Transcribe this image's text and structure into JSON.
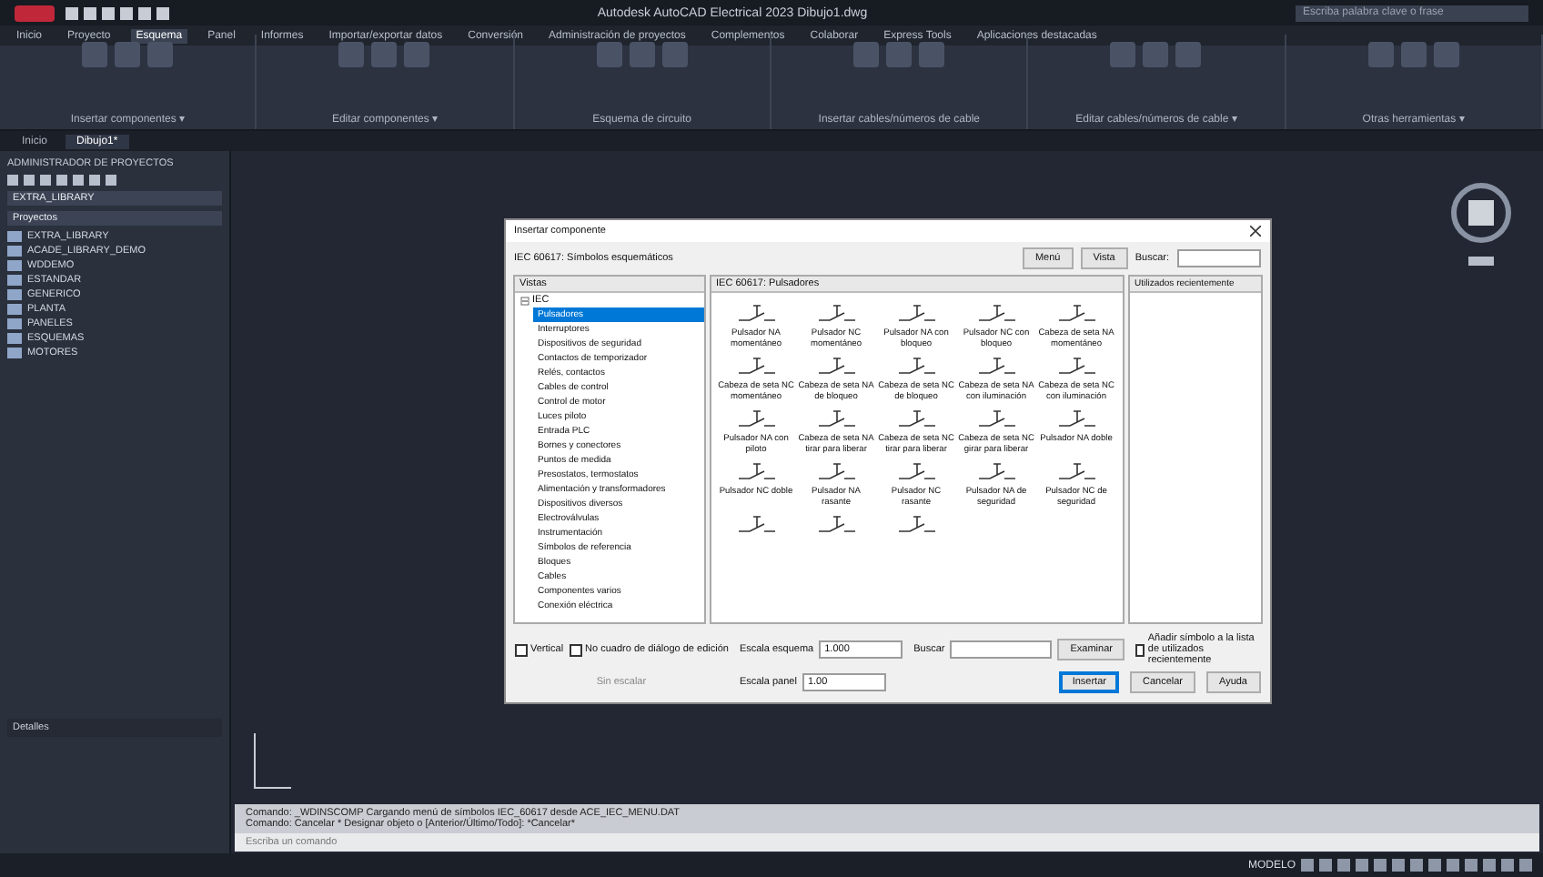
{
  "app": {
    "title": "Autodesk AutoCAD Electrical 2023  Dibujo1.dwg",
    "search_placeholder": "Escriba palabra clave o frase"
  },
  "ribbon_tabs": [
    {
      "label": "Inicio",
      "selected": false
    },
    {
      "label": "Proyecto",
      "selected": false
    },
    {
      "label": "Esquema",
      "selected": true
    },
    {
      "label": "Panel",
      "selected": false
    },
    {
      "label": "Informes",
      "selected": false
    },
    {
      "label": "Importar/exportar datos",
      "selected": false
    },
    {
      "label": "Conversión",
      "selected": false
    },
    {
      "label": "Administración de proyectos",
      "selected": false
    },
    {
      "label": "Complementos",
      "selected": false
    },
    {
      "label": "Colaborar",
      "selected": false
    },
    {
      "label": "Express Tools",
      "selected": false
    },
    {
      "label": "Aplicaciones destacadas",
      "selected": false
    }
  ],
  "ribbon_panels": [
    "Insertar componentes ▾",
    "Editar componentes ▾",
    "Esquema de circuito",
    "Insertar cables/números de cable",
    "Editar cables/números de cable ▾",
    "Otras herramientas ▾"
  ],
  "file_tabs": [
    {
      "label": "Inicio",
      "selected": false
    },
    {
      "label": "Dibujo1*",
      "selected": true
    }
  ],
  "palette": {
    "title": "ADMINISTRADOR DE PROYECTOS",
    "project": "EXTRA_LIBRARY",
    "filter": "Proyectos",
    "projects": [
      "EXTRA_LIBRARY",
      "ACADE_LIBRARY_DEMO",
      "WDDEMO",
      "ESTANDAR",
      "GENERICO",
      "PLANTA",
      "PANELES",
      "ESQUEMAS",
      "MOTORES"
    ],
    "details": "Detalles"
  },
  "dialog": {
    "title": "Insertar componente",
    "subtitle": "IEC 60617: Símbolos esquemáticos",
    "menu_button": "Menú",
    "view_button": "Vista",
    "search_label": "Buscar:",
    "tree_header": "Vistas",
    "tree": [
      {
        "label": "IEC",
        "expanded": true,
        "children": [
          {
            "label": "Pulsadores",
            "selected": true
          },
          {
            "label": "Interruptores",
            "selected": false
          },
          {
            "label": "Dispositivos de seguridad",
            "selected": false
          },
          {
            "label": "Contactos de temporizador",
            "selected": false
          },
          {
            "label": "Relés, contactos",
            "selected": false
          },
          {
            "label": "Cables de control",
            "selected": false
          },
          {
            "label": "Control de motor",
            "selected": false
          },
          {
            "label": "Luces piloto",
            "selected": false
          },
          {
            "label": "Entrada PLC",
            "selected": false
          },
          {
            "label": "Bornes y conectores",
            "selected": false
          },
          {
            "label": "Puntos de medida",
            "selected": false
          },
          {
            "label": "Presostatos, termostatos",
            "selected": false
          },
          {
            "label": "Alimentación y transformadores",
            "selected": false
          },
          {
            "label": "Dispositivos diversos",
            "selected": false
          },
          {
            "label": "Electroválvulas",
            "selected": false
          },
          {
            "label": "Instrumentación",
            "selected": false
          },
          {
            "label": "Símbolos de referencia",
            "selected": false
          },
          {
            "label": "Bloques",
            "selected": false
          },
          {
            "label": "Cables",
            "selected": false
          },
          {
            "label": "Componentes varios",
            "selected": false
          },
          {
            "label": "Conexión eléctrica",
            "selected": false
          }
        ]
      }
    ],
    "grid_header": "IEC 60617: Pulsadores",
    "symbols": [
      {
        "kind": "labeled",
        "label": "Pulsador NA momentáneo"
      },
      {
        "kind": "labeled",
        "label": "Pulsador NC momentáneo"
      },
      {
        "kind": "labeled",
        "label": "Pulsador NA con bloqueo"
      },
      {
        "kind": "labeled",
        "label": "Pulsador NC con bloqueo"
      },
      {
        "kind": "labeled",
        "label": "Cabeza de seta NA momentáneo"
      },
      {
        "kind": "labeled",
        "label": "Cabeza de seta NC momentáneo"
      },
      {
        "kind": "labeled",
        "label": "Cabeza de seta NA de bloqueo"
      },
      {
        "kind": "labeled",
        "label": "Cabeza de seta NC de bloqueo"
      },
      {
        "kind": "labeled",
        "label": "Cabeza de seta NA con iluminación"
      },
      {
        "kind": "labeled",
        "label": "Cabeza de seta NC con iluminación"
      },
      {
        "kind": "labeled",
        "label": "Pulsador NA con piloto"
      },
      {
        "kind": "labeled",
        "label": "Cabeza de seta NA tirar para liberar"
      },
      {
        "kind": "labeled",
        "label": "Cabeza de seta NC tirar para liberar"
      },
      {
        "kind": "labeled",
        "label": "Cabeza de seta NC girar para liberar"
      },
      {
        "kind": "labeled",
        "label": "Pulsador NA doble"
      },
      {
        "kind": "labeled",
        "label": "Pulsador NC doble"
      },
      {
        "kind": "labeled",
        "label": "Pulsador NA rasante"
      },
      {
        "kind": "labeled",
        "label": "Pulsador NC rasante"
      },
      {
        "kind": "labeled",
        "label": "Pulsador NA de seguridad"
      },
      {
        "kind": "labeled",
        "label": "Pulsador NC de seguridad"
      },
      {
        "kind": "unlabeled"
      },
      {
        "kind": "unlabeled"
      },
      {
        "kind": "unlabeled"
      }
    ],
    "recent_header": "Utilizados recientemente",
    "vertical": {
      "label": "Vertical",
      "checked": false
    },
    "no_edit": {
      "label": "No cuadro de diálogo de edición",
      "checked": false
    },
    "unscaled": "Sin escalar",
    "schematic_scale_label": "Escala esquema",
    "schematic_scale": "1.000",
    "panel_scale_label": "Escala panel",
    "panel_scale": "1.00",
    "search_field_label": "Buscar",
    "browse": "Examinar",
    "add_recent": {
      "label": "Añadir símbolo a la lista de utilizados recientemente",
      "checked": false
    },
    "buttons": [
      {
        "label": "Insertar",
        "default": true
      },
      {
        "label": "Cancelar",
        "default": false
      },
      {
        "label": "Ayuda",
        "default": false
      }
    ]
  },
  "command_history": [
    "Comando: _WDINSCOMP Cargando menú de símbolos IEC_60617 desde ACE_IEC_MENU.DAT",
    "Comando: Cancelar *  Designar objeto o [Anterior/Último/Todo]: *Cancelar*"
  ],
  "command_placeholder": "Escriba un comando",
  "status": {
    "mode": "MODELO"
  }
}
